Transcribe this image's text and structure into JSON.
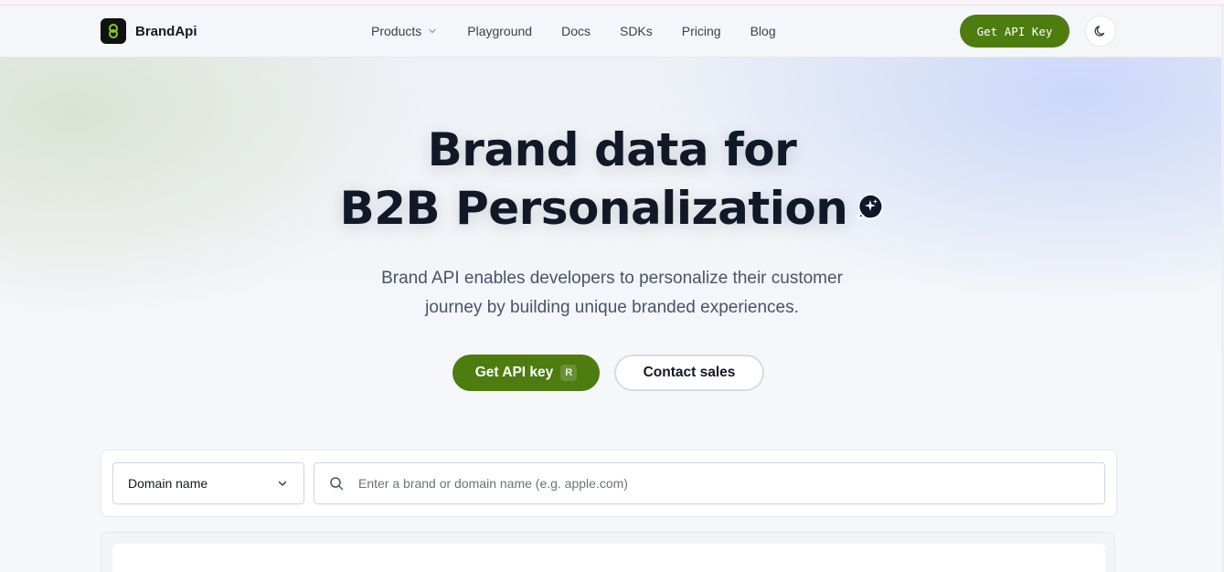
{
  "header": {
    "brand_name": "BrandApi",
    "nav": [
      {
        "label": "Products",
        "has_dropdown": true
      },
      {
        "label": "Playground"
      },
      {
        "label": "Docs"
      },
      {
        "label": "SDKs"
      },
      {
        "label": "Pricing"
      },
      {
        "label": "Blog"
      }
    ],
    "cta_label": "Get API Key",
    "theme_toggle_icon": "moon-icon"
  },
  "hero": {
    "title_line1": "Brand data for",
    "title_line2": "B2B Personalization",
    "subtitle_line1": "Brand API enables developers to personalize their customer",
    "subtitle_line2": "journey by building unique branded experiences.",
    "primary_cta": {
      "label": "Get API key",
      "shortcut": "R"
    },
    "secondary_cta": {
      "label": "Contact sales"
    }
  },
  "search": {
    "select_value": "Domain name",
    "placeholder": "Enter a brand or domain name (e.g. apple.com)"
  },
  "colors": {
    "accent": "#4d7c0f",
    "text": "#111827"
  }
}
